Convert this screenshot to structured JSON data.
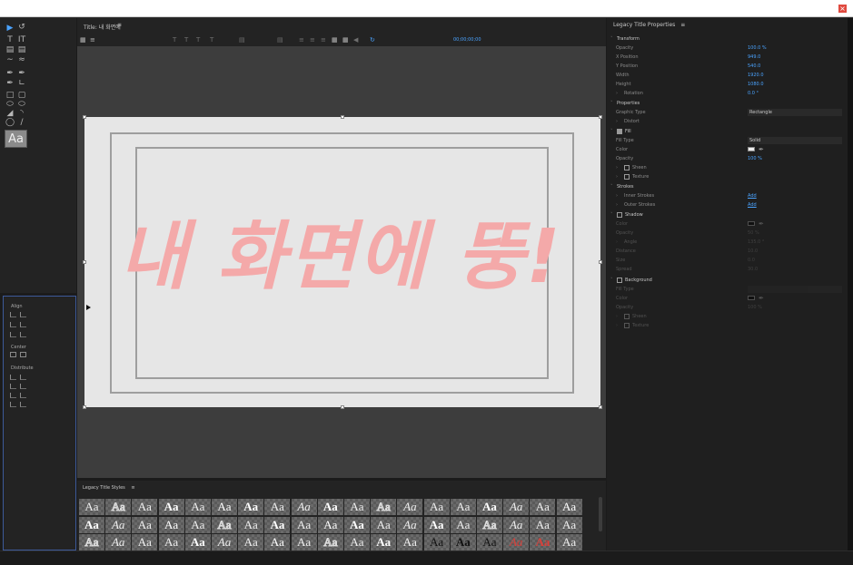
{
  "window": {
    "close_label": "×"
  },
  "tools": {
    "type_tool_label": "T",
    "vertical_type_label": "IT",
    "style_sample": "Aa"
  },
  "align_panel": {
    "align_label": "Align",
    "center_label": "Center",
    "distribute_label": "Distribute"
  },
  "title_window": {
    "header": "Title: 내 화면에",
    "timecode": "00;00;00;00",
    "headline_text": "내 화면에 뚱!"
  },
  "styles_panel": {
    "header": "Legacy Title Styles",
    "rows": [
      [
        "Aa",
        "Aa",
        "Aa",
        "Aa",
        "Aa",
        "Aa",
        "Aa",
        "Aa",
        "Aa",
        "Aa",
        "Aa",
        "Aa",
        "Aa",
        "Aa",
        "Aa",
        "Aa",
        "Aa",
        "Aa",
        "Aa"
      ],
      [
        "Aa",
        "Aa",
        "Aa",
        "Aa",
        "Aa",
        "Aa",
        "Aa",
        "Aa",
        "Aa",
        "Aa",
        "Aa",
        "Aa",
        "Aa",
        "Aa",
        "Aa",
        "Aa",
        "Aa",
        "Aa",
        "Aa"
      ],
      [
        "Aa",
        "Aa",
        "Aa",
        "Aa",
        "Aa",
        "Aa",
        "Aa",
        "Aa",
        "Aa",
        "Aa",
        "Aa",
        "Aa",
        "Aa",
        "Aa",
        "Aa",
        "Aa",
        "Aa",
        "Aa",
        "Aa"
      ]
    ]
  },
  "properties": {
    "header": "Legacy Title Properties",
    "transform": {
      "section": "Transform",
      "opacity_label": "Opacity",
      "opacity": "100.0 %",
      "x_label": "X Position",
      "x": "949.0",
      "y_label": "Y Position",
      "y": "540.0",
      "width_label": "Width",
      "width": "1920.0",
      "height_label": "Height",
      "height": "1080.0",
      "rotation_label": "Rotation",
      "rotation": "0.0 °"
    },
    "props": {
      "section": "Properties",
      "graphic_type_label": "Graphic Type",
      "graphic_type": "Rectangle",
      "distort_label": "Distort"
    },
    "fill": {
      "section": "Fill",
      "fill_type_label": "Fill Type",
      "fill_type": "Solid",
      "color_label": "Color",
      "opacity_label": "Opacity",
      "opacity": "100 %",
      "sheen_label": "Sheen",
      "texture_label": "Texture"
    },
    "strokes": {
      "section": "Strokes",
      "inner_label": "Inner Strokes",
      "inner_add": "Add",
      "outer_label": "Outer Strokes",
      "outer_add": "Add"
    },
    "shadow": {
      "section": "Shadow",
      "color_label": "Color",
      "opacity_label": "Opacity",
      "opacity": "50 %",
      "angle_label": "Angle",
      "angle": "135.0 °",
      "distance_label": "Distance",
      "distance": "10.0",
      "size_label": "Size",
      "size": "0.0",
      "spread_label": "Spread",
      "spread": "30.0"
    },
    "background": {
      "section": "Background",
      "fill_type_label": "Fill Type",
      "color_label": "Color",
      "opacity_label": "Opacity",
      "opacity": "100 %",
      "sheen_label": "Sheen",
      "texture_label": "Texture"
    }
  },
  "colors": {
    "accent": "#4aa3ff",
    "headline": "#f4a9a9",
    "close": "#e04a3f"
  }
}
